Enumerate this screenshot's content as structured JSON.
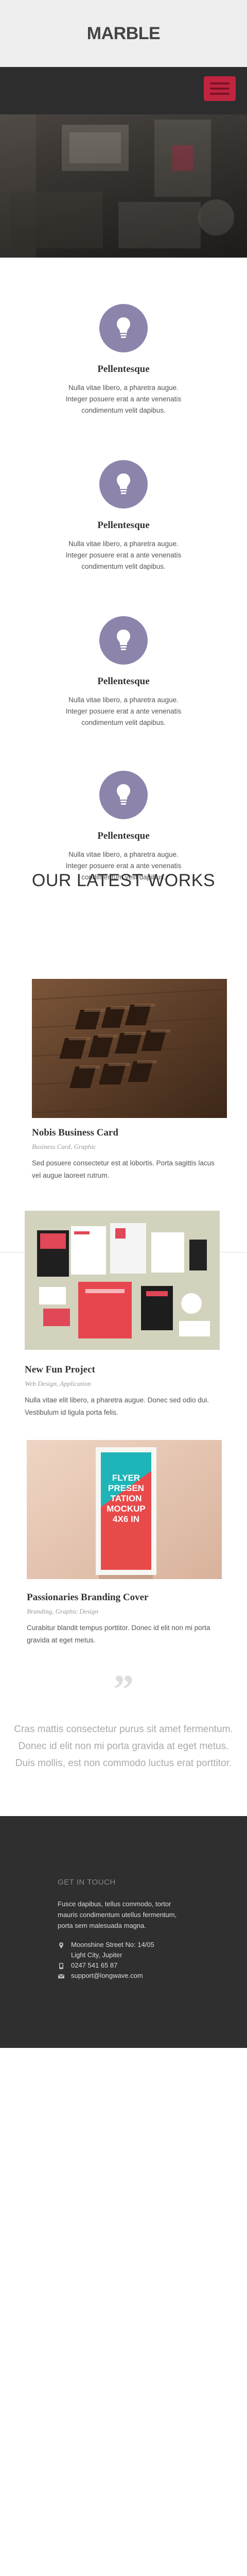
{
  "header": {
    "logo": "MARBLE"
  },
  "features": [
    {
      "title": "Pellentesque",
      "line1": "Nulla vitae libero, a pharetra augue.",
      "line2": "Integer posuere erat a ante venenatis",
      "line3": "condimentum velit dapibus."
    },
    {
      "title": "Pellentesque",
      "line1": "Nulla vitae libero, a pharetra augue.",
      "line2": "Integer posuere erat a ante venenatis",
      "line3": "condimentum velit dapibus."
    },
    {
      "title": "Pellentesque",
      "line1": "Nulla vitae libero, a pharetra augue.",
      "line2": "Integer posuere erat a ante venenatis",
      "line3": "condimentum velit dapibus."
    },
    {
      "title": "Pellentesque",
      "line1": "Nulla vitae libero, a pharetra augue.",
      "line2": "Integer posuere erat a ante venenatis",
      "line3": "condimentum velit dapibus."
    }
  ],
  "works": {
    "title": "OUR LATEST WORKS",
    "items": [
      {
        "title": "Nobis Business Card",
        "category": "Business Card, Graphic",
        "line1": "Sed posuere consectetur est at lobortis. Porta sagittis lacus",
        "line2": "vel augue laoreet rutrum."
      },
      {
        "title": "New Fun Project",
        "category": "Web Design, Application",
        "line1": "Nulla vitae elit libero, a pharetra augue. Donec sed odio dui.",
        "line2": "Vestibulum id ligula porta felis."
      },
      {
        "title": "Passionaries Branding Cover",
        "category": "Branding, Graphic Design",
        "line1": "Curabitur blandit tempus porttitor. Donec id elit non mi porta",
        "line2": "gravida at eget metus."
      }
    ],
    "poster_text": [
      "FLYER",
      "PRESEN",
      "TATION",
      "MOCKUP",
      "4X6 IN"
    ]
  },
  "quote": {
    "line1": "Cras mattis consectetur purus sit amet fermentum.",
    "line2": "Donec id elit non mi porta gravida at eget metus.",
    "line3": "Duis mollis, est non commodo luctus erat porttitor."
  },
  "footer": {
    "heading": "GET IN TOUCH",
    "line1": "Fusce dapibus, tellus commodo, tortor",
    "line2": "mauris condimentum utellus fermentum,",
    "line3": "porta sem malesuada magna.",
    "address1": "Moonshine Street No: 14/05",
    "address2": "Light City, Jupiter",
    "phone": "0247 541 65 87",
    "email": "support@longwave.com"
  },
  "colors": {
    "accent": "#c0243f",
    "feature_circle": "#8c84ab",
    "footer_bg": "#2f2f2f",
    "header_bg": "#eeeeee",
    "nav_bg": "#2d2d2d"
  },
  "icons": {
    "feature": "lightbulb-icon",
    "menu": "hamburger-icon",
    "quote": "quote-icon",
    "address": "location-icon",
    "phone": "phone-icon",
    "email": "mail-icon"
  }
}
